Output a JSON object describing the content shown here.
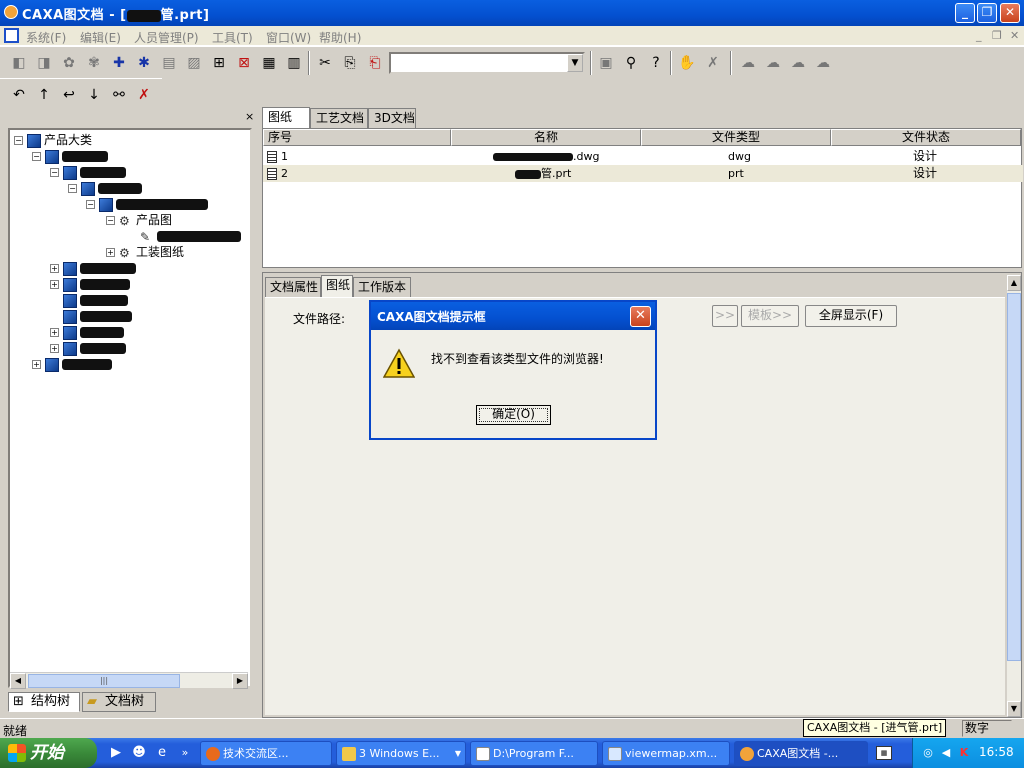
{
  "window": {
    "title": "CAXA图文档 - [",
    "title_suffix": "管.prt]",
    "min_label": "_",
    "max_label": "❐",
    "close_label": "✕"
  },
  "menu": {
    "items": [
      "系统(F)",
      "编辑(E)",
      "人员管理(P)",
      "工具(T)",
      "窗口(W)",
      "帮助(H)"
    ],
    "mdi_min": "_",
    "mdi_restore": "❐",
    "mdi_close": "✕"
  },
  "toolbar": {
    "combo_value": "",
    "combo_arrow": "▼"
  },
  "left_panel": {
    "close_label": "×",
    "tree": {
      "root": "产品大类",
      "product_drawing": "产品图",
      "fixture_drawing": "工装图纸"
    },
    "tabs": [
      "结构树",
      "文档树"
    ]
  },
  "top_tabs": [
    "图纸",
    "工艺文档",
    "3D文档"
  ],
  "file_list": {
    "columns": [
      "序号",
      "名称",
      "文件类型",
      "文件状态"
    ],
    "rows": [
      {
        "index": "1",
        "name": ".dwg",
        "type": "dwg",
        "status": "设计"
      },
      {
        "index": "2",
        "name": "管.prt",
        "type": "prt",
        "status": "设计"
      }
    ]
  },
  "lower_tabs": [
    "文档属性",
    "图纸",
    "工作版本"
  ],
  "lower_panel": {
    "path_label": "文件路径:",
    "btn_next": ">>",
    "btn_template": "模板>>",
    "btn_fullscreen": "全屏显示(F)"
  },
  "dialog": {
    "title": "CAXA图文档提示框",
    "message": "找不到查看该类型文件的浏览器!",
    "ok_label": "确定(O)",
    "close_label": "✕"
  },
  "status": {
    "text": "就绪",
    "num_label": "数字",
    "tooltip": "CAXA图文档 - [进气管.prt]"
  },
  "taskbar": {
    "start_label": "开始",
    "more_label": "»",
    "tasks": [
      "技术交流区...",
      "3 Windows E...",
      "D:\\Program F...",
      "viewermap.xm...",
      "CAXA图文档 -..."
    ],
    "clock": "16:58"
  }
}
